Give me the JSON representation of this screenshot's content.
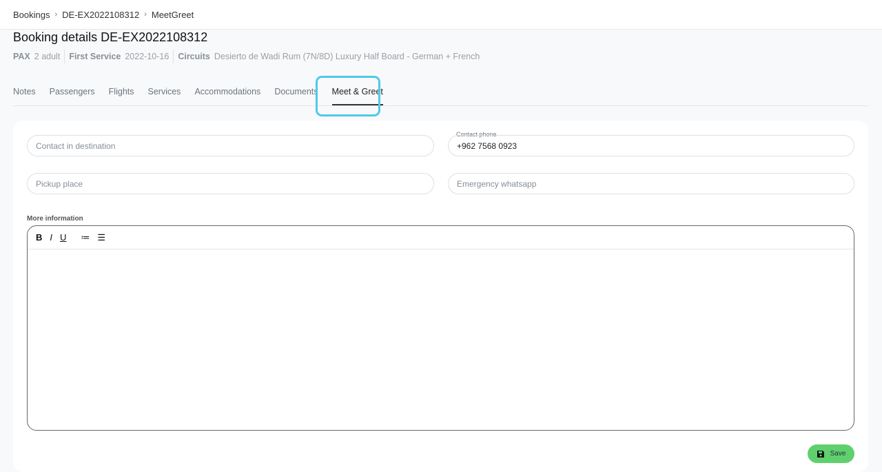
{
  "breadcrumb": [
    "Bookings",
    "DE-EX2022108312",
    "MeetGreet"
  ],
  "title": "Booking details DE-EX2022108312",
  "meta": {
    "pax_label": "PAX",
    "pax": "2 adult",
    "first_label": "First Service",
    "first": "2022-10-16",
    "circ_label": "Circuits",
    "circ": "Desierto de Wadi Rum (7N/8D) Luxury Half Board - German + French"
  },
  "tabs": [
    "Notes",
    "Passengers",
    "Flights",
    "Services",
    "Accommodations",
    "Documents",
    "Meet & Greet"
  ],
  "form": {
    "contact_placeholder": "Contact in destination",
    "phone_label": "Contact phone",
    "phone": "+962 7568 0923",
    "pickup_placeholder": "Pickup place",
    "whatsapp_placeholder": "Emergency whatsapp",
    "more_label": "More information",
    "save": "Save"
  },
  "toolbar": {
    "bold": "B",
    "italic": "I",
    "underline": "U",
    "ol": "≔",
    "ul": "☰"
  }
}
